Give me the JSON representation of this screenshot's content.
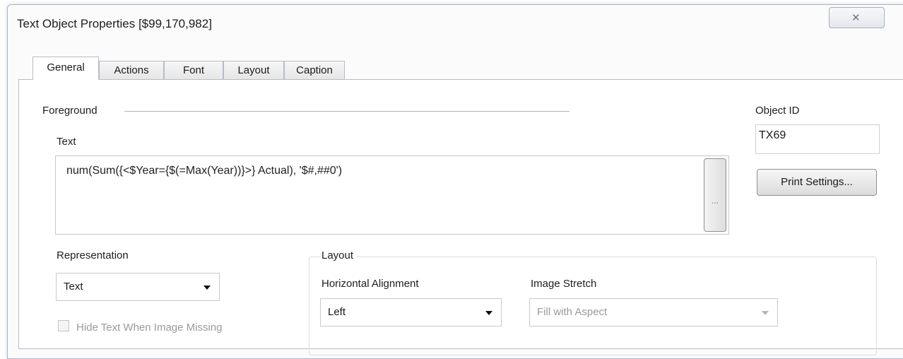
{
  "window": {
    "title": "Text Object Properties [$99,170,982]",
    "close_glyph": "✕"
  },
  "tabs": [
    {
      "label": "General",
      "active": true
    },
    {
      "label": "Actions",
      "active": false
    },
    {
      "label": "Font",
      "active": false
    },
    {
      "label": "Layout",
      "active": false
    },
    {
      "label": "Caption",
      "active": false
    }
  ],
  "foreground": {
    "section_label": "Foreground",
    "text_label": "Text",
    "text_value": "num(Sum({<$Year={$(=Max(Year))}>} Actual), '$#,##0')",
    "ellipsis_label": "..."
  },
  "object": {
    "id_label": "Object ID",
    "id_value": "TX69",
    "print_settings_label": "Print Settings..."
  },
  "representation": {
    "label": "Representation",
    "selected": "Text",
    "hide_text_label": "Hide Text When Image Missing",
    "hide_text_checked": false
  },
  "layout": {
    "label": "Layout",
    "horizontal_alignment_label": "Horizontal Alignment",
    "horizontal_alignment_value": "Left",
    "image_stretch_label": "Image Stretch",
    "image_stretch_value": "Fill with Aspect"
  },
  "colors": {
    "window_border": "#a9b6c8",
    "disabled_text": "#9a9a9a"
  }
}
